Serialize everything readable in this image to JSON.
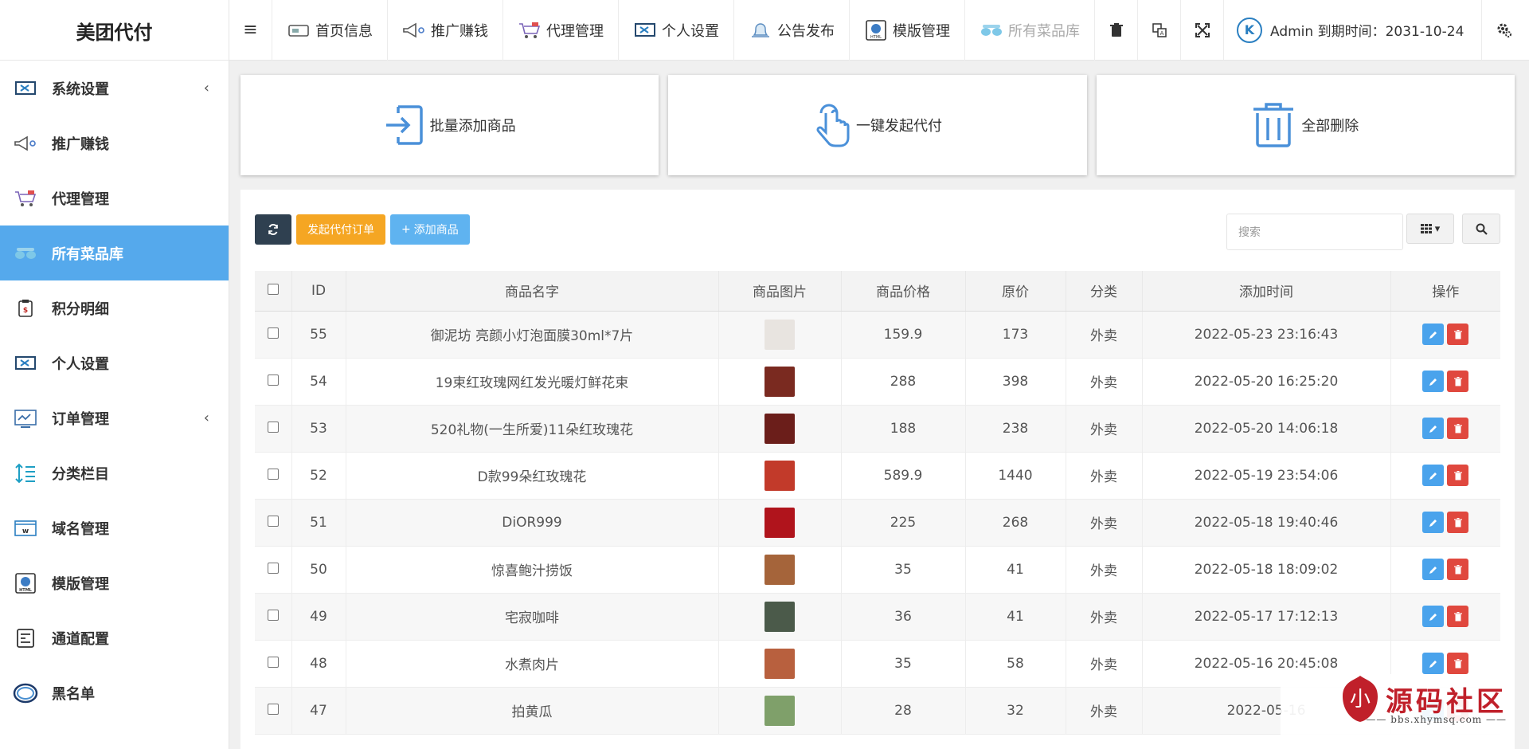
{
  "brand": "美团代付",
  "topnav": [
    {
      "label": "首页信息",
      "icon": "home-info-icon",
      "disabled": false
    },
    {
      "label": "推广赚钱",
      "icon": "megaphone-icon",
      "disabled": false
    },
    {
      "label": "代理管理",
      "icon": "cart-icon",
      "disabled": false
    },
    {
      "label": "个人设置",
      "icon": "monitor-tools-icon",
      "disabled": false
    },
    {
      "label": "公告发布",
      "icon": "bell-icon",
      "disabled": false
    },
    {
      "label": "模版管理",
      "icon": "html-globe-icon",
      "disabled": false
    },
    {
      "label": "所有菜品库",
      "icon": "dishes-icon",
      "disabled": true
    }
  ],
  "admin": {
    "avatar_letter": "K",
    "text": "Admin 到期时间：2031-10-24"
  },
  "sidebar": [
    {
      "label": "系统设置",
      "icon": "monitor-tools-icon",
      "chevron": "‹",
      "active": false
    },
    {
      "label": "推广赚钱",
      "icon": "megaphone-icon",
      "chevron": "",
      "active": false
    },
    {
      "label": "代理管理",
      "icon": "cart-icon",
      "chevron": "",
      "active": false
    },
    {
      "label": "所有菜品库",
      "icon": "dishes-icon",
      "chevron": "",
      "active": true
    },
    {
      "label": "积分明细",
      "icon": "points-icon",
      "chevron": "",
      "active": false
    },
    {
      "label": "个人设置",
      "icon": "monitor-tools-icon",
      "chevron": "",
      "active": false
    },
    {
      "label": "订单管理",
      "icon": "order-icon",
      "chevron": "‹",
      "active": false
    },
    {
      "label": "分类栏目",
      "icon": "category-list-icon",
      "chevron": "",
      "active": false
    },
    {
      "label": "域名管理",
      "icon": "domain-icon",
      "chevron": "",
      "active": false
    },
    {
      "label": "模版管理",
      "icon": "html-globe-icon",
      "chevron": "",
      "active": false
    },
    {
      "label": "通道配置",
      "icon": "channel-config-icon",
      "chevron": "",
      "active": false
    },
    {
      "label": "黑名单",
      "icon": "blacklist-ring-icon",
      "chevron": "",
      "active": false
    }
  ],
  "cards": [
    {
      "label": "批量添加商品",
      "icon": "batch-add-icon"
    },
    {
      "label": "一键发起代付",
      "icon": "tap-hand-icon"
    },
    {
      "label": "全部删除",
      "icon": "trash-icon"
    }
  ],
  "toolbar": {
    "launch_label": "发起代付订单",
    "add_label": "添加商品",
    "add_prefix": "+",
    "search_placeholder": "搜索"
  },
  "table": {
    "headers": [
      "ID",
      "商品名字",
      "商品图片",
      "商品价格",
      "原价",
      "分类",
      "添加时间",
      "操作"
    ],
    "rows": [
      {
        "id": "55",
        "name": "御泥坊 亮颜小灯泡面膜30ml*7片",
        "price": "159.9",
        "orig": "173",
        "cat": "外卖",
        "time": "2022-05-23 23:16:43",
        "thumb": "#e8e4e0"
      },
      {
        "id": "54",
        "name": "19束红玫瑰网红发光暖灯鲜花束",
        "price": "288",
        "orig": "398",
        "cat": "外卖",
        "time": "2022-05-20 16:25:20",
        "thumb": "#7a2a20"
      },
      {
        "id": "53",
        "name": "520礼物(一生所爱)11朵红玫瑰花",
        "price": "188",
        "orig": "238",
        "cat": "外卖",
        "time": "2022-05-20 14:06:18",
        "thumb": "#6b1e1a"
      },
      {
        "id": "52",
        "name": "D款99朵红玫瑰花",
        "price": "589.9",
        "orig": "1440",
        "cat": "外卖",
        "time": "2022-05-19 23:54:06",
        "thumb": "#c23a2a"
      },
      {
        "id": "51",
        "name": "DiOR999",
        "price": "225",
        "orig": "268",
        "cat": "外卖",
        "time": "2022-05-18 19:40:46",
        "thumb": "#b0141c"
      },
      {
        "id": "50",
        "name": "惊喜鲍汁捞饭",
        "price": "35",
        "orig": "41",
        "cat": "外卖",
        "time": "2022-05-18 18:09:02",
        "thumb": "#a5643a"
      },
      {
        "id": "49",
        "name": "宅寂咖啡",
        "price": "36",
        "orig": "41",
        "cat": "外卖",
        "time": "2022-05-17 17:12:13",
        "thumb": "#4b5a4a"
      },
      {
        "id": "48",
        "name": "水煮肉片",
        "price": "35",
        "orig": "58",
        "cat": "外卖",
        "time": "2022-05-16 20:45:08",
        "thumb": "#b8603e"
      },
      {
        "id": "47",
        "name": "拍黄瓜",
        "price": "28",
        "orig": "32",
        "cat": "外卖",
        "time": "2022-05-16",
        "thumb": "#7fa06a"
      }
    ]
  },
  "watermark": {
    "title": "源码社区",
    "url": "bbs.xhymsq.com",
    "logo_text": "小"
  }
}
